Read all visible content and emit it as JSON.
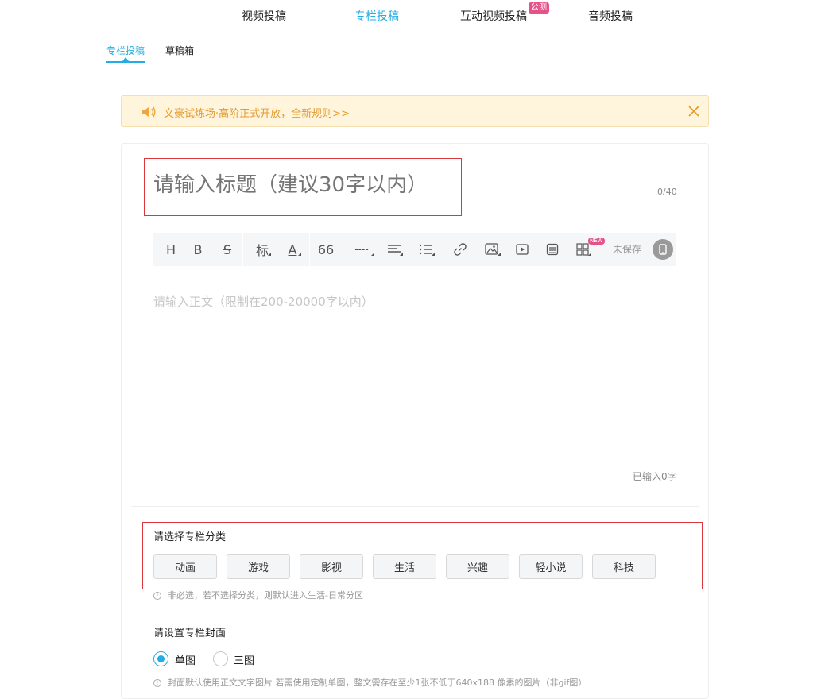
{
  "top_tabs": [
    {
      "label": "视频投稿"
    },
    {
      "label": "专栏投稿",
      "active": true
    },
    {
      "label": "互动视频投稿",
      "badge": "公测"
    },
    {
      "label": "音频投稿"
    }
  ],
  "sub_tabs": [
    {
      "label": "专栏投稿",
      "active": true
    },
    {
      "label": "草稿箱"
    }
  ],
  "notice": {
    "icon": "speaker-icon",
    "text": "文豪试炼场·高阶正式开放，全新规则>>",
    "close_icon": "close-icon"
  },
  "editor": {
    "title_placeholder": "请输入标题（建议30字以内）",
    "title_count": "0/40",
    "body_placeholder": "请输入正文（限制在200-20000字以内）",
    "word_count": "已输入0字",
    "unsaved": "未保存",
    "toolbar": {
      "heading": "H",
      "bold": "B",
      "strike": "S",
      "tag": "标",
      "font_color": "A",
      "quote": "66",
      "divider": "----",
      "new_badge": "NEW"
    }
  },
  "category": {
    "label": "请选择专栏分类",
    "options": [
      "动画",
      "游戏",
      "影视",
      "生活",
      "兴趣",
      "轻小说",
      "科技"
    ],
    "hint": "非必选，若不选择分类，则默认进入生活-日常分区"
  },
  "cover": {
    "label": "请设置专栏封面",
    "options": [
      {
        "label": "单图",
        "checked": true
      },
      {
        "label": "三图",
        "checked": false
      }
    ],
    "hint": "封面默认使用正文文字图片 若需使用定制单图，整文需存在至少1张不低于640x188 像素的图片（非gif图）"
  },
  "colors": {
    "accent": "#23ade5",
    "badge": "#e5528a",
    "notice_text": "#e59b2c",
    "notice_bg": "#fff4dc",
    "highlight_border": "#d9363e"
  }
}
